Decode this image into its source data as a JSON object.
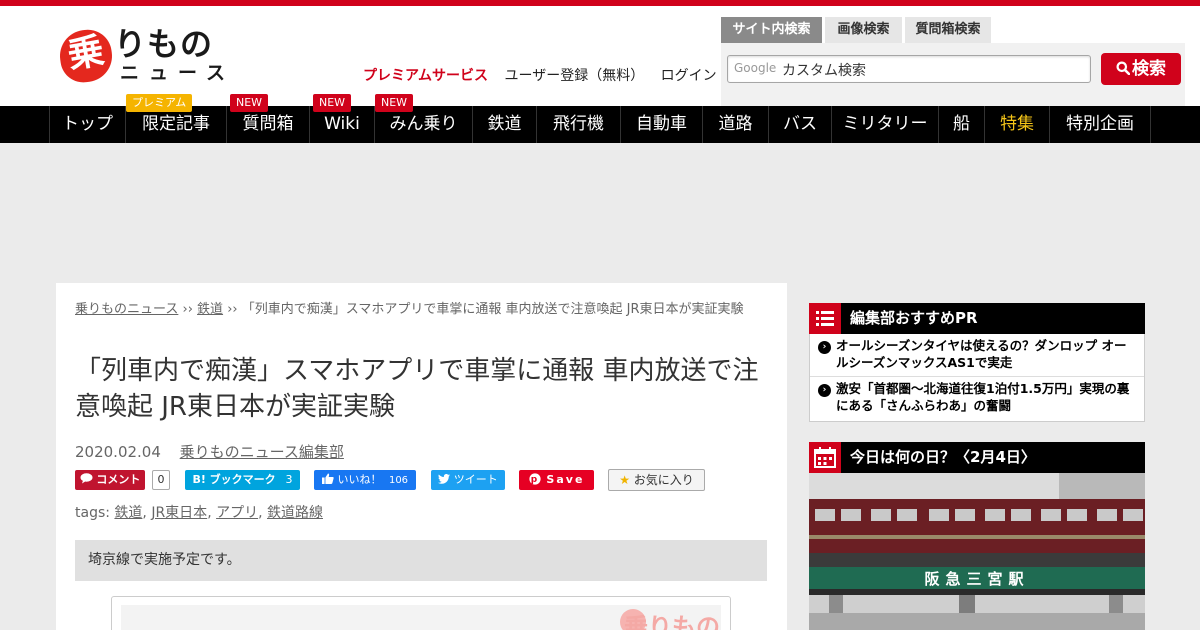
{
  "header": {
    "logo_kanji": "乗",
    "logo_text": "りもの",
    "logo_sub": "ニュース",
    "premium_link": "プレミアムサービス",
    "register_link": "ユーザー登録（無料）",
    "login_link": "ログイン"
  },
  "search": {
    "tabs": [
      "サイト内検索",
      "画像検索",
      "質問箱検索"
    ],
    "active_tab": "サイト内検索",
    "google_label": "Google",
    "placeholder": "カスタム検索",
    "button_label": "検索"
  },
  "nav": {
    "items": [
      {
        "label": "トップ"
      },
      {
        "label": "限定記事",
        "badge": "プレミアム"
      },
      {
        "label": "質問箱",
        "badge": "NEW"
      },
      {
        "label": "Wiki",
        "badge": "NEW"
      },
      {
        "label": "みん乗り",
        "badge": "NEW"
      },
      {
        "label": "鉄道"
      },
      {
        "label": "飛行機"
      },
      {
        "label": "自動車"
      },
      {
        "label": "道路"
      },
      {
        "label": "バス"
      },
      {
        "label": "ミリタリー"
      },
      {
        "label": "船"
      },
      {
        "label": "特集"
      },
      {
        "label": "特別企画"
      }
    ]
  },
  "breadcrumb": {
    "home": "乗りものニュース",
    "sep": "››",
    "category": "鉄道",
    "current": "「列車内で痴漢」スマホアプリで車掌に通報 車内放送で注意喚起 JR東日本が実証実験"
  },
  "article": {
    "title": "「列車内で痴漢」スマホアプリで車掌に通報 車内放送で注意喚起 JR東日本が実証実験",
    "date": "2020.02.04",
    "author": "乗りものニュース編集部",
    "tags_label": "tags:",
    "tags": [
      "鉄道",
      "JR東日本",
      "アプリ",
      "鉄道路線"
    ],
    "summary": "埼京線で実施予定です。",
    "figure_logo": "乗りもの"
  },
  "share": {
    "comment_label": "コメント",
    "comment_count": "0",
    "hatena_label": "B! ブックマーク",
    "hatena_count": "3",
    "fb_label": "いいね！",
    "fb_count": "106",
    "tweet_label": "ツイート",
    "pin_label": "Save",
    "fav_label": "お気に入り"
  },
  "sidebar": {
    "pr_title": "編集部おすすめPR",
    "pr_items": [
      "オールシーズンタイヤは使えるの？ダンロップ オールシーズンマックスAS1で実走",
      "激安「首都圏～北海道往復1泊付1.5万円」実現の裏にある「さんふらわあ」の奮闘"
    ],
    "today_title": "今日は何の日？〈2月4日〉",
    "photo_sign": "阪急三宮駅"
  },
  "colors": {
    "brand_red": "#d0021b",
    "nav_bg": "#000000",
    "feature_yellow": "#f5c518",
    "premium_badge": "#f5b400",
    "hankyu_maroon": "#6b1f24"
  }
}
